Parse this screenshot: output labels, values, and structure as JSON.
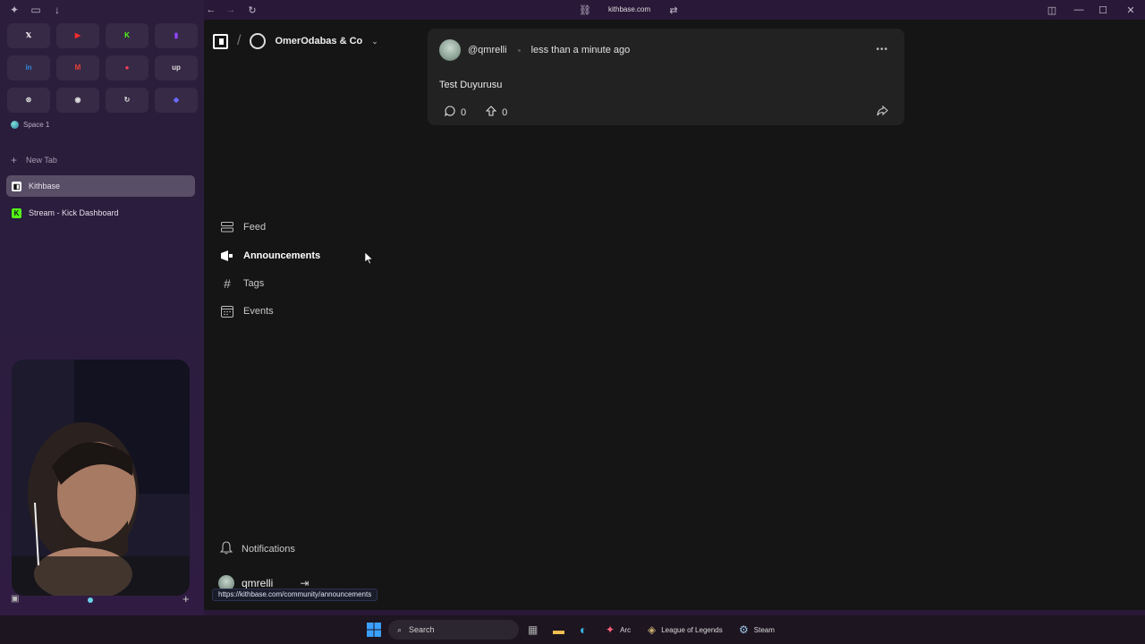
{
  "browser": {
    "url": "kithbase.com",
    "space_label": "Space 1",
    "new_tab_label": "New Tab",
    "tabs": [
      {
        "label": "Kithbase",
        "icon": "kithbase-icon",
        "active": true
      },
      {
        "label": "Stream - Kick Dashboard",
        "icon": "kick-icon",
        "active": false
      }
    ],
    "favorites": [
      {
        "icon": "x-icon",
        "glyph": "𝕏",
        "color": "#ffffff"
      },
      {
        "icon": "youtube-icon",
        "glyph": "▶",
        "color": "#ff2a2a"
      },
      {
        "icon": "kick-icon",
        "glyph": "K",
        "color": "#53fc18"
      },
      {
        "icon": "twitch-icon",
        "glyph": "▮",
        "color": "#9146ff"
      },
      {
        "icon": "linkedin-icon",
        "glyph": "in",
        "color": "#2e8ad8"
      },
      {
        "icon": "gmail-icon",
        "glyph": "M",
        "color": "#e94235"
      },
      {
        "icon": "record-icon",
        "glyph": "●",
        "color": "#ff3b5c"
      },
      {
        "icon": "upwork-icon",
        "glyph": "up",
        "color": "#dddddd"
      },
      {
        "icon": "openai-icon",
        "glyph": "⊛",
        "color": "#dddddd"
      },
      {
        "icon": "target-icon",
        "glyph": "◉",
        "color": "#dddddd"
      },
      {
        "icon": "sync-icon",
        "glyph": "↻",
        "color": "#dddddd"
      },
      {
        "icon": "gem-icon",
        "glyph": "◆",
        "color": "#6b6bff"
      }
    ],
    "status_url": "https://kithbase.com/community/announcements"
  },
  "app": {
    "org_name": "OmerOdabas & Co",
    "nav": [
      {
        "label": "Feed",
        "icon": "feed-icon",
        "active": false
      },
      {
        "label": "Announcements",
        "icon": "megaphone-icon",
        "active": true
      },
      {
        "label": "Tags",
        "icon": "hash-icon",
        "active": false
      },
      {
        "label": "Events",
        "icon": "calendar-icon",
        "active": false
      }
    ],
    "notifications_label": "Notifications",
    "username": "qmrelli"
  },
  "post": {
    "author": "@qmrelli",
    "time": "less than a minute ago",
    "body": "Test Duyurusu",
    "comments": "0",
    "upvotes": "0"
  },
  "taskbar": {
    "search_placeholder": "Search",
    "apps": [
      {
        "label": "Arc",
        "icon": "arc-icon"
      },
      {
        "label": "League of Legends",
        "icon": "lol-icon"
      },
      {
        "label": "Steam",
        "icon": "steam-icon"
      }
    ]
  }
}
